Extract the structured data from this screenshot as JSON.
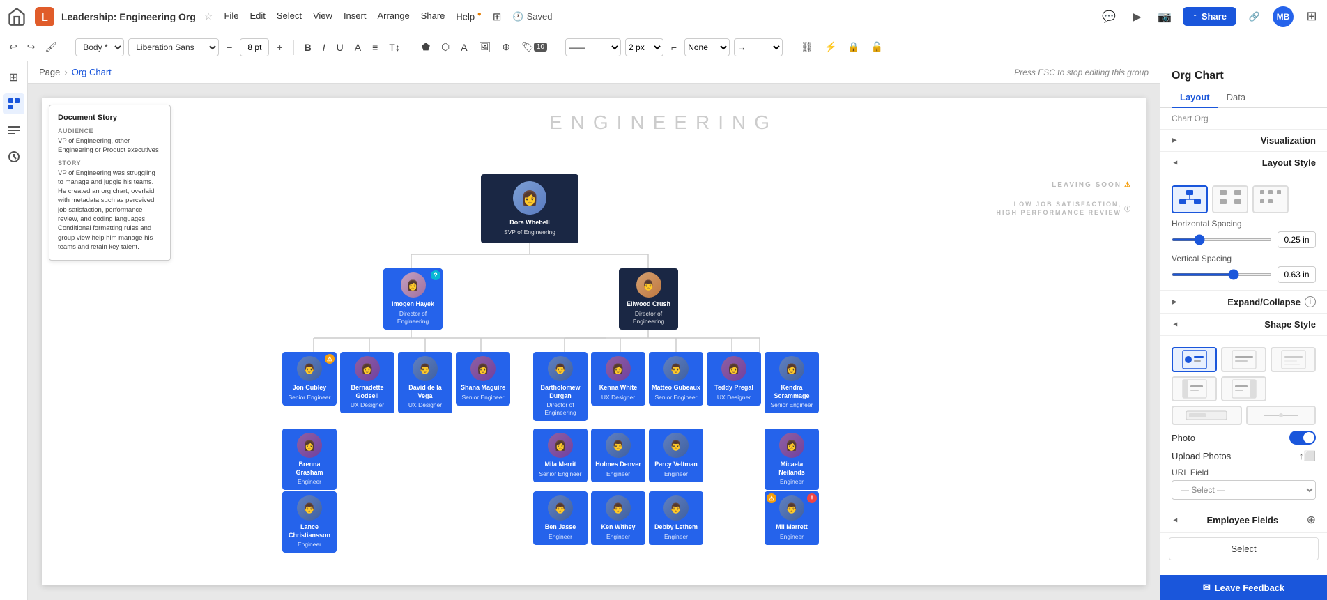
{
  "app": {
    "title": "Leadership: Engineering Org",
    "home_icon": "home-icon",
    "logo_icon": "logo-icon"
  },
  "menu": {
    "items": [
      "File",
      "Edit",
      "Select",
      "View",
      "Insert",
      "Arrange",
      "Share",
      "Help",
      "Share"
    ]
  },
  "toolbar": {
    "body_label": "Body *",
    "font_label": "Liberation Sans",
    "font_size": "8 pt",
    "bold": "B",
    "italic": "I",
    "underline": "U",
    "badge_num": "10",
    "line_style": "——",
    "px_val": "2 px",
    "none_label": "None",
    "saved_label": "Saved",
    "share_label": "Share"
  },
  "breadcrumb": {
    "page": "Page",
    "chart": "Org Chart",
    "hint": "Press ESC to stop editing this group"
  },
  "doc_story": {
    "title": "Document Story",
    "audience_label": "AUDIENCE",
    "audience_text": "VP of Engineering, other Engineering or Product executives",
    "story_label": "STORY",
    "story_text": "VP of Engineering was struggling to manage and juggle his teams. He created an org chart, overlaid with metadata such as perceived job satisfaction, performance review, and coding languages. Conditional formatting rules and group view help him manage his teams and retain key talent."
  },
  "canvas": {
    "eng_label": "ENGINEERING",
    "leaving_soon": "LEAVING SOON",
    "low_job": "LOW JOB SATISFACTION,\nHIGH PERFORMANCE REVIEW"
  },
  "org_chart": {
    "root": {
      "name": "Dora Whebell",
      "title": "SVP of Engineering"
    },
    "level2": [
      {
        "name": "Imogen Hayek",
        "title": "Director of Engineering",
        "badge": "?"
      },
      {
        "name": "Ellwood Crush",
        "title": "Director of Engineering"
      }
    ],
    "level3": [
      {
        "name": "Jon Cubley",
        "title": "Senior Engineer",
        "badge": "⚠"
      },
      {
        "name": "Bernadette Godsell",
        "title": "UX Designer"
      },
      {
        "name": "David de la Vega",
        "title": "UX Designer"
      },
      {
        "name": "Shana Maguire",
        "title": "Senior Engineer"
      },
      {
        "name": "Bartholomew Durgan",
        "title": "Director of Engineering"
      },
      {
        "name": "Kenna White",
        "title": "UX Designer"
      },
      {
        "name": "Matteo Gubeaux",
        "title": "Senior Engineer"
      },
      {
        "name": "Teddy Pregal",
        "title": "UX Designer"
      },
      {
        "name": "Kendra Scrammage",
        "title": "Senior Engineer"
      }
    ],
    "level4": [
      {
        "name": "Brenna Grasham",
        "title": "Engineer"
      },
      {
        "name": "Mila Merrit",
        "title": "Senior Engineer"
      },
      {
        "name": "Holmes Denver",
        "title": "Engineer"
      },
      {
        "name": "Parcy Veltman",
        "title": "Engineer"
      },
      {
        "name": "Micaela Neilands",
        "title": "Engineer"
      }
    ],
    "level5": [
      {
        "name": "Lance Christiansson",
        "title": "Engineer"
      },
      {
        "name": "Ben Jasse",
        "title": "Engineer"
      },
      {
        "name": "Ken Withey",
        "title": "Engineer"
      },
      {
        "name": "Debby Lethem",
        "title": "Engineer"
      },
      {
        "name": "Mil Marrett",
        "title": "Engineer",
        "badge": "⚠!"
      }
    ]
  },
  "right_panel": {
    "title": "Org Chart",
    "tabs": [
      "Layout",
      "Data"
    ],
    "active_tab": "Layout",
    "sections": {
      "visualization": {
        "label": "Visualization",
        "collapsed": true
      },
      "layout_style": {
        "label": "Layout Style",
        "collapsed": false
      },
      "expand_collapse": {
        "label": "Expand/Collapse",
        "collapsed": true
      },
      "shape_style": {
        "label": "Shape Style",
        "collapsed": false
      },
      "employee_fields": {
        "label": "Employee Fields",
        "collapsed": false
      }
    },
    "horizontal_spacing_label": "Horizontal Spacing",
    "horizontal_spacing_val": "0.25 in",
    "vertical_spacing_label": "Vertical Spacing",
    "vertical_spacing_val": "0.63 in",
    "photo_label": "Photo",
    "upload_photos_label": "Upload Photos",
    "url_field_label": "URL Field",
    "url_placeholder": "— Select —",
    "select_btn_label": "Select",
    "leave_feedback_label": "Leave Feedback",
    "chart_org_label": "Chart Org",
    "shape_styles": [
      "card-photo",
      "card-simple",
      "card-minimal",
      "bar-left",
      "bar-right"
    ]
  },
  "colors": {
    "brand_blue": "#1a56db",
    "node_dark": "#1a2744",
    "node_blue": "#2563eb",
    "accent_warn": "#f59e0b",
    "accent_info": "#06b6d4"
  }
}
